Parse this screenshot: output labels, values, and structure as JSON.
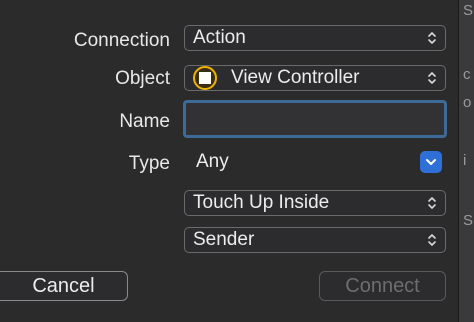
{
  "connection": {
    "label": "Connection",
    "value": "Action"
  },
  "object": {
    "label": "Object",
    "value": "View Controller"
  },
  "name": {
    "label": "Name",
    "value": "",
    "placeholder": ""
  },
  "type": {
    "label": "Type",
    "value": "Any"
  },
  "event": {
    "value": "Touch Up Inside"
  },
  "arguments": {
    "value": "Sender"
  },
  "buttons": {
    "cancel": "Cancel",
    "connect": "Connect"
  },
  "edge_glyphs": [
    "S",
    "c",
    "o",
    "i",
    "S"
  ],
  "colors": {
    "panel": "#2b2b2c",
    "focus_ring": "#3d6a96",
    "accent_blue": "#2f6fd8",
    "object_icon": "#f0b400"
  }
}
